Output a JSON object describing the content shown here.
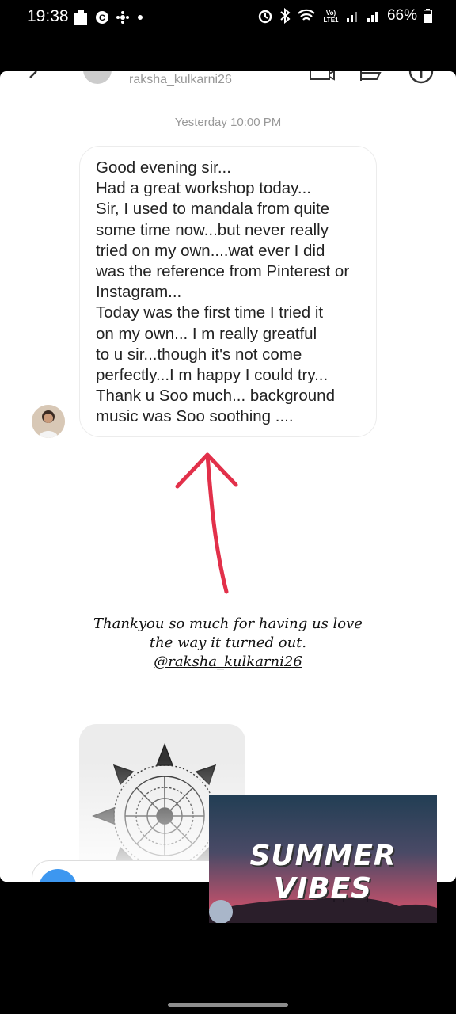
{
  "status_bar": {
    "time": "19:38",
    "battery": "66%"
  },
  "dm": {
    "username": "raksha_kulkarni26",
    "timestamp": "Yesterday 10:00 PM",
    "message": "Good evening sir...\nHad a great workshop today...\nSir, I used to mandala from quite\nsome time now...but never really\ntried on my own....wat ever I did\nwas the reference from Pinterest or\nInstagram...\nToday was the first time I tried it\non my own... I m really greatful\nto u sir...though it's not come\nperfectly...I m happy I could try...\nThank u Soo much... background\nmusic was Soo soothing ...."
  },
  "story": {
    "caption_line1": "Thankyou so much for having us love",
    "caption_line2": "the way it turned out.",
    "mention": "@raksha_kulkarni26"
  },
  "music_sticker": {
    "title": "SUMMER  VIBES"
  },
  "colors": {
    "arrow": "#e2304a",
    "accent": "#3d97f0"
  }
}
